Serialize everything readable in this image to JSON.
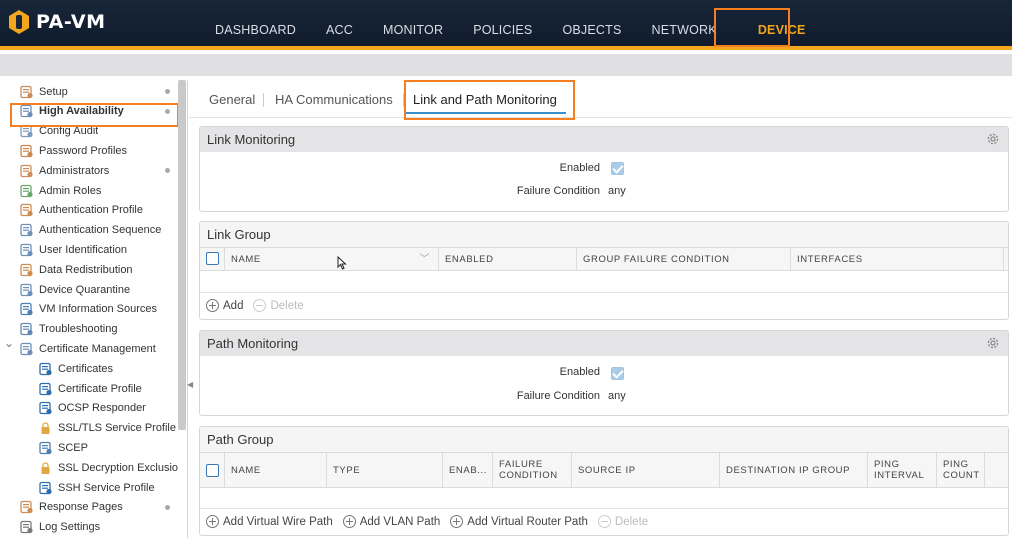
{
  "app": {
    "logo_text": "PA-VM",
    "brand_color": "#f4a61d",
    "highlight_color": "#f57f20"
  },
  "nav": {
    "items": [
      "DASHBOARD",
      "ACC",
      "MONITOR",
      "POLICIES",
      "OBJECTS",
      "NETWORK",
      "DEVICE"
    ],
    "active": "DEVICE"
  },
  "sidebar": {
    "items": [
      {
        "label": "Setup",
        "icon": "setup-icon"
      },
      {
        "label": "High Availability",
        "icon": "high-availability-icon"
      },
      {
        "label": "Config Audit",
        "icon": "config-audit-icon"
      },
      {
        "label": "Password Profiles",
        "icon": "password-profiles-icon"
      },
      {
        "label": "Administrators",
        "icon": "administrators-icon"
      },
      {
        "label": "Admin Roles",
        "icon": "admin-roles-icon"
      },
      {
        "label": "Authentication Profile",
        "icon": "authentication-profile-icon"
      },
      {
        "label": "Authentication Sequence",
        "icon": "authentication-sequence-icon"
      },
      {
        "label": "User Identification",
        "icon": "user-identification-icon"
      },
      {
        "label": "Data Redistribution",
        "icon": "data-redistribution-icon"
      },
      {
        "label": "Device Quarantine",
        "icon": "device-quarantine-icon"
      },
      {
        "label": "VM Information Sources",
        "icon": "vm-information-sources-icon"
      },
      {
        "label": "Troubleshooting",
        "icon": "troubleshooting-icon"
      },
      {
        "label": "Certificate Management",
        "icon": "certificate-management-icon"
      },
      {
        "label": "Certificates",
        "icon": "certificates-icon"
      },
      {
        "label": "Certificate Profile",
        "icon": "certificate-profile-icon"
      },
      {
        "label": "OCSP Responder",
        "icon": "ocsp-responder-icon"
      },
      {
        "label": "SSL/TLS Service Profile",
        "icon": "lock-icon"
      },
      {
        "label": "SCEP",
        "icon": "scep-icon"
      },
      {
        "label": "SSL Decryption Exclusion",
        "icon": "lock-icon"
      },
      {
        "label": "SSH Service Profile",
        "icon": "ssh-service-profile-icon"
      },
      {
        "label": "Response Pages",
        "icon": "response-pages-icon"
      },
      {
        "label": "Log Settings",
        "icon": "log-settings-icon"
      }
    ],
    "selected": "High Availability"
  },
  "tabs": {
    "items": [
      "General",
      "HA Communications",
      "Link and Path Monitoring"
    ],
    "active": "Link and Path Monitoring"
  },
  "link_monitoring": {
    "title": "Link Monitoring",
    "enabled_label": "Enabled",
    "failure_label": "Failure Condition",
    "failure_value": "any"
  },
  "link_group": {
    "title": "Link Group",
    "columns": [
      "NAME",
      "ENABLED",
      "GROUP FAILURE CONDITION",
      "INTERFACES"
    ],
    "actions": {
      "add": "Add",
      "delete": "Delete"
    }
  },
  "path_monitoring": {
    "title": "Path Monitoring",
    "enabled_label": "Enabled",
    "failure_label": "Failure Condition",
    "failure_value": "any"
  },
  "path_group": {
    "title": "Path Group",
    "columns": {
      "name": "NAME",
      "type": "TYPE",
      "enabled": "ENAB...",
      "failure_1": "FAILURE",
      "failure_2": "CONDITION",
      "source_ip": "SOURCE IP",
      "dest_group": "DESTINATION IP GROUP",
      "ping_interval_1": "PING",
      "ping_interval_2": "INTERVAL",
      "ping_count_1": "PING",
      "ping_count_2": "COUNT"
    },
    "actions": {
      "add_vwire": "Add Virtual Wire Path",
      "add_vlan": "Add VLAN Path",
      "add_vrouter": "Add Virtual Router Path",
      "delete": "Delete"
    }
  }
}
